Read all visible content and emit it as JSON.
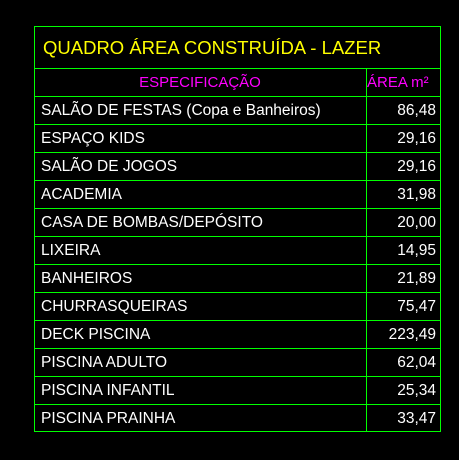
{
  "table": {
    "title": "QUADRO ÁREA CONSTRUÍDA - LAZER",
    "header": {
      "col1": "ESPECIFICAÇÃO",
      "col2": "ÁREA m²"
    },
    "rows": [
      {
        "name": "SALÃO DE FESTAS (Copa e Banheiros)",
        "area": "86,48"
      },
      {
        "name": "ESPAÇO KIDS",
        "area": "29,16"
      },
      {
        "name": "SALÃO DE JOGOS",
        "area": "29,16"
      },
      {
        "name": "ACADEMIA",
        "area": "31,98"
      },
      {
        "name": "CASA DE BOMBAS/DEPÓSITO",
        "area": "20,00"
      },
      {
        "name": "LIXEIRA",
        "area": "14,95"
      },
      {
        "name": "BANHEIROS",
        "area": "21,89"
      },
      {
        "name": "CHURRASQUEIRAS",
        "area": "75,47"
      },
      {
        "name": "DECK PISCINA",
        "area": "223,49"
      },
      {
        "name": "PISCINA ADULTO",
        "area": "62,04"
      },
      {
        "name": "PISCINA INFANTIL",
        "area": "25,34"
      },
      {
        "name": "PISCINA PRAINHA",
        "area": "33,47"
      }
    ]
  },
  "colors": {
    "background": "#000000",
    "border": "#00ff00",
    "title": "#ffff00",
    "header": "#ff00ff",
    "text": "#ffffff"
  }
}
